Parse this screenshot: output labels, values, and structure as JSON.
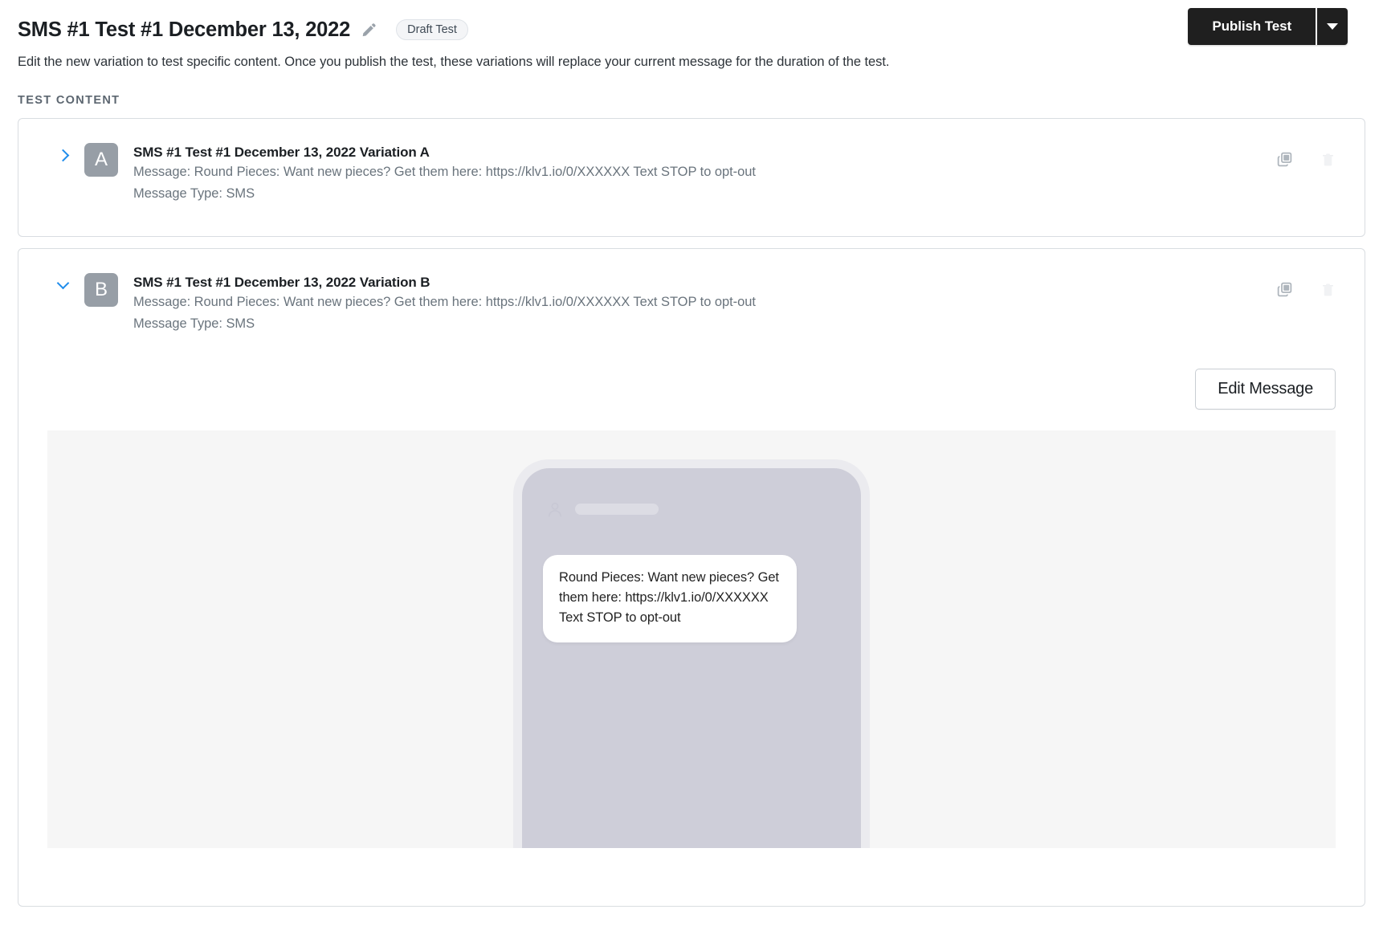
{
  "header": {
    "title": "SMS #1 Test #1 December 13, 2022",
    "edit_title_icon": "pencil-icon",
    "status_badge": "Draft Test",
    "subtitle": "Edit the new variation to test specific content. Once you publish the test, these variations will replace your current message for the duration of the test.",
    "publish_label": "Publish Test",
    "publish_caret_icon": "chevron-down-icon"
  },
  "section": {
    "label": "TEST CONTENT"
  },
  "variations": [
    {
      "letter": "A",
      "title": "SMS #1 Test #1 December 13, 2022 Variation A",
      "message_line": "Message: Round Pieces: Want new pieces? Get them here: https://klv1.io/0/XXXXXX Text STOP to opt-out",
      "message_type_line": "Message Type: SMS",
      "expanded": false,
      "chevron_icon": "chevron-right-icon",
      "duplicate_icon": "duplicate-icon",
      "delete_icon": "trash-icon"
    },
    {
      "letter": "B",
      "title": "SMS #1 Test #1 December 13, 2022 Variation B",
      "message_line": "Message: Round Pieces: Want new pieces? Get them here: https://klv1.io/0/XXXXXX Text STOP to opt-out",
      "message_type_line": "Message Type: SMS",
      "expanded": true,
      "chevron_icon": "chevron-down-icon",
      "duplicate_icon": "duplicate-icon",
      "delete_icon": "trash-icon",
      "edit_message_label": "Edit Message",
      "preview": {
        "bubble_text": "Round Pieces: Want new pieces? Get them here: https://klv1.io/0/XXXXXX Text STOP to opt-out",
        "contact_icon": "person-icon"
      }
    }
  ],
  "colors": {
    "accent_blue": "#1f8ceb",
    "publish_button_bg": "#1f1f1f",
    "badge_gray": "#979ea6",
    "phone_screen": "#ceced9",
    "preview_panel": "#f6f6f6"
  }
}
